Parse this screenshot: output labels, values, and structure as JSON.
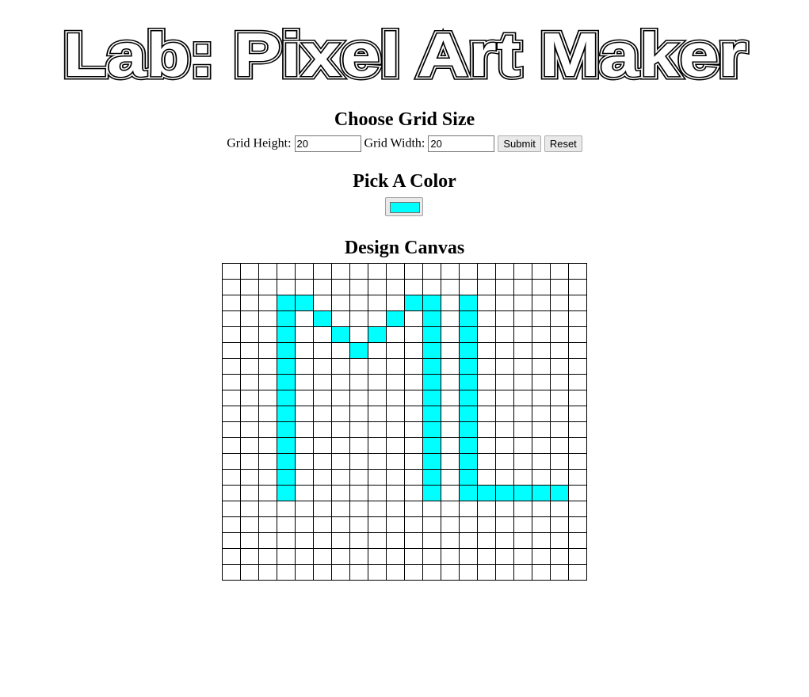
{
  "header": {
    "title": "Lab: Pixel Art Maker"
  },
  "grid_size": {
    "heading": "Choose Grid Size",
    "height_label": "Grid Height:",
    "height_value": "20",
    "width_label": "Grid Width:",
    "width_value": "20",
    "submit_label": "Submit",
    "reset_label": "Reset"
  },
  "color_picker": {
    "heading": "Pick A Color",
    "value": "#00ffff"
  },
  "canvas": {
    "heading": "Design Canvas",
    "rows": 20,
    "cols": 20,
    "empty_color": "#ffffff",
    "fill_color": "#00ffff",
    "filled_cells": [
      [
        2,
        3
      ],
      [
        2,
        4
      ],
      [
        2,
        10
      ],
      [
        2,
        11
      ],
      [
        2,
        13
      ],
      [
        3,
        3
      ],
      [
        3,
        5
      ],
      [
        3,
        9
      ],
      [
        3,
        11
      ],
      [
        3,
        13
      ],
      [
        4,
        3
      ],
      [
        4,
        6
      ],
      [
        4,
        8
      ],
      [
        4,
        11
      ],
      [
        4,
        13
      ],
      [
        5,
        3
      ],
      [
        5,
        7
      ],
      [
        5,
        11
      ],
      [
        5,
        13
      ],
      [
        6,
        3
      ],
      [
        6,
        11
      ],
      [
        6,
        13
      ],
      [
        7,
        3
      ],
      [
        7,
        11
      ],
      [
        7,
        13
      ],
      [
        8,
        3
      ],
      [
        8,
        11
      ],
      [
        8,
        13
      ],
      [
        9,
        3
      ],
      [
        9,
        11
      ],
      [
        9,
        13
      ],
      [
        10,
        3
      ],
      [
        10,
        11
      ],
      [
        10,
        13
      ],
      [
        11,
        3
      ],
      [
        11,
        11
      ],
      [
        11,
        13
      ],
      [
        12,
        3
      ],
      [
        12,
        11
      ],
      [
        12,
        13
      ],
      [
        13,
        3
      ],
      [
        13,
        11
      ],
      [
        13,
        13
      ],
      [
        14,
        3
      ],
      [
        14,
        11
      ],
      [
        14,
        13
      ],
      [
        14,
        14
      ],
      [
        14,
        15
      ],
      [
        14,
        16
      ],
      [
        14,
        17
      ],
      [
        14,
        18
      ]
    ]
  }
}
